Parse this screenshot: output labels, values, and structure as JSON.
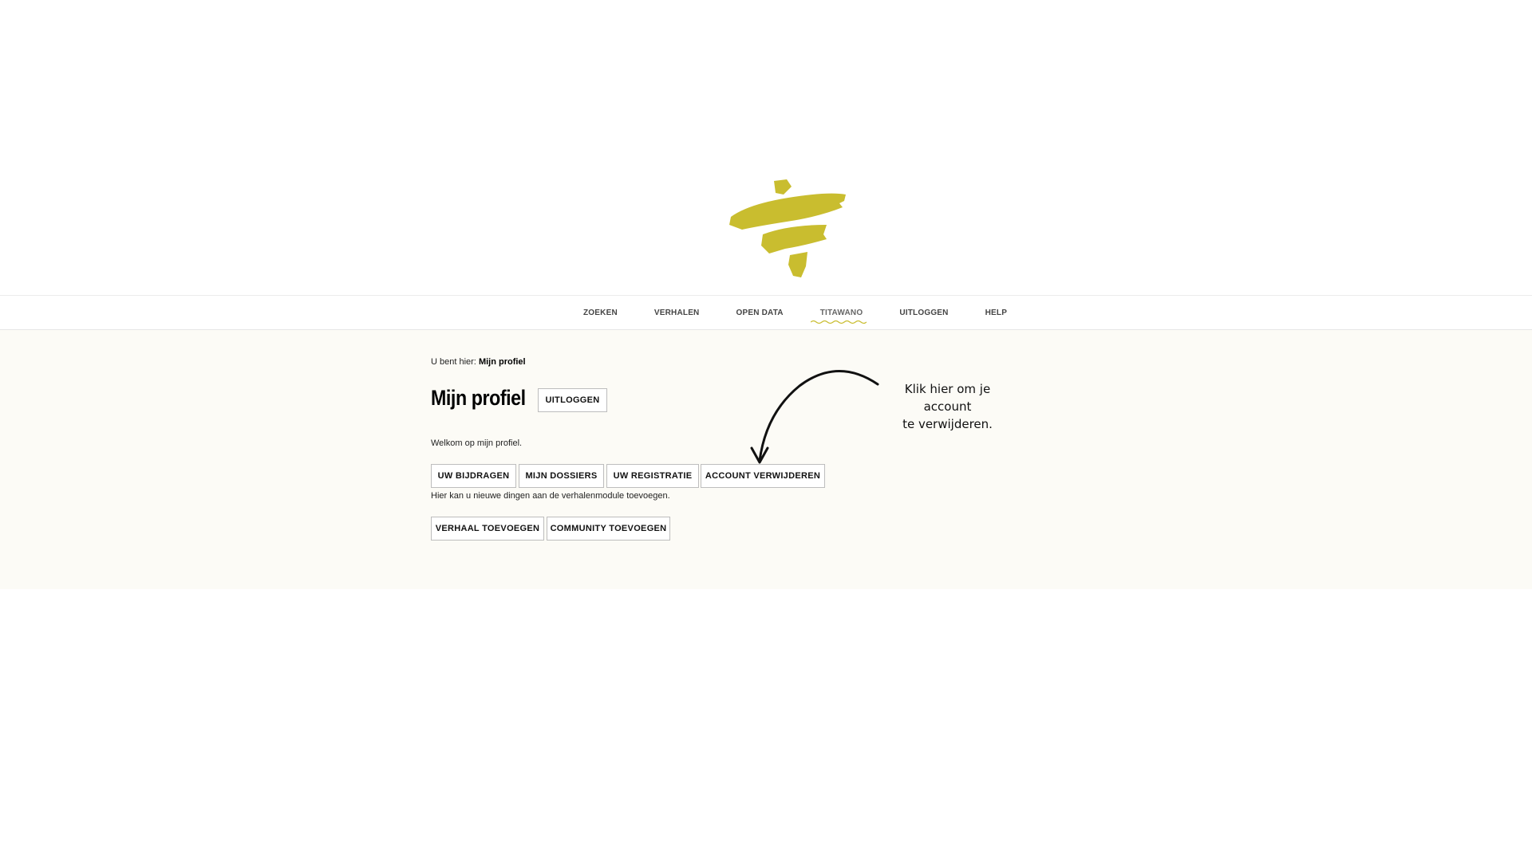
{
  "logo": {
    "icon": "brand-logo-icon",
    "color": "#c9bd2f"
  },
  "nav": {
    "items": [
      {
        "label": "ZOEKEN"
      },
      {
        "label": "VERHALEN"
      },
      {
        "label": "OPEN DATA"
      },
      {
        "label": "TITAWANO",
        "active": true
      },
      {
        "label": "UITLOGGEN"
      },
      {
        "label": "HELP"
      }
    ]
  },
  "breadcrumb": {
    "prefix": "U bent hier:",
    "current": "Mijn profiel"
  },
  "page": {
    "title": "Mijn profiel",
    "logout_label": "UITLOGGEN",
    "welcome_text": "Welkom op mijn profiel.",
    "hint_text": "Hier kan u nieuwe dingen aan de verhalenmodule toevoegen."
  },
  "profile_tabs": [
    {
      "label": "UW BIJDRAGEN"
    },
    {
      "label": "MIJN DOSSIERS"
    },
    {
      "label": "UW REGISTRATIE"
    },
    {
      "label": "ACCOUNT VERWIJDEREN"
    }
  ],
  "actions": [
    {
      "label": "VERHAAL TOEVOEGEN"
    },
    {
      "label": "COMMUNITY TOEVOEGEN"
    }
  ],
  "annotation": {
    "text": "Klik hier om je\naccount\nte verwijderen."
  },
  "colors": {
    "accent": "#c9bd2f",
    "content_bg": "#fcfbf6",
    "nav_underline": "#c9bd2f"
  }
}
